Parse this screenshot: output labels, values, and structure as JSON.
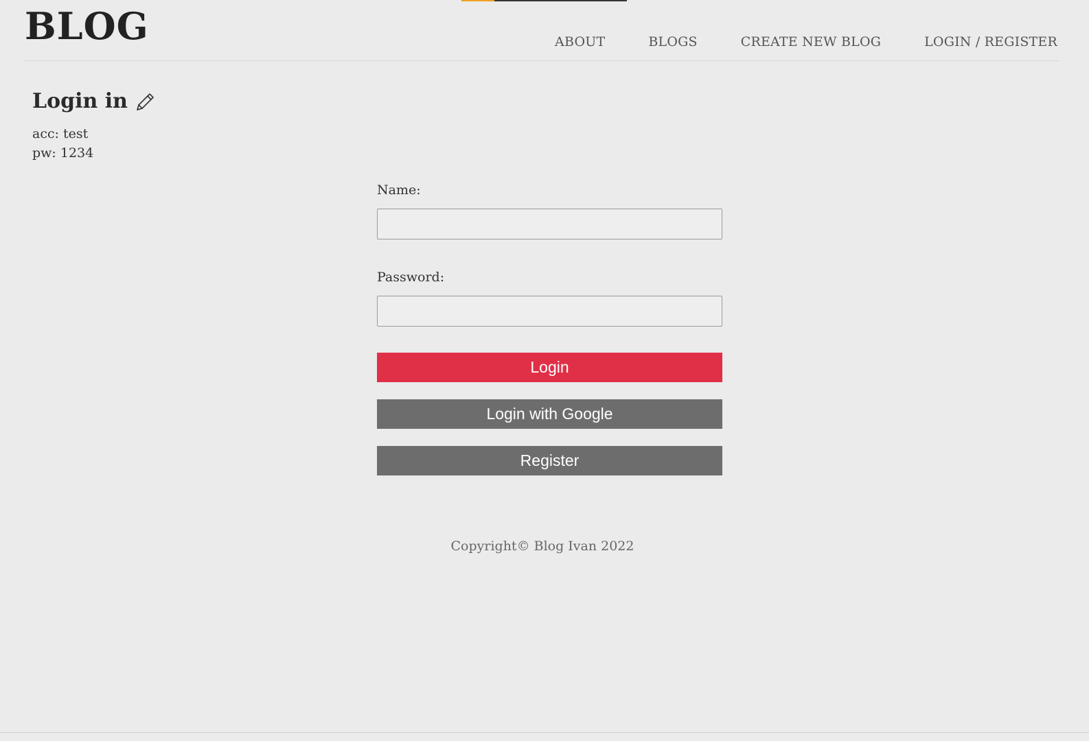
{
  "header": {
    "logo": "BLOG",
    "nav": [
      {
        "label": "ABOUT"
      },
      {
        "label": "BLOGS"
      },
      {
        "label": "CREATE NEW BLOG"
      },
      {
        "label": "LOGIN / REGISTER"
      }
    ]
  },
  "page": {
    "title": "Login in",
    "title_icon": "pencil-icon",
    "hint_account": "acc: test",
    "hint_password": "pw: 1234"
  },
  "form": {
    "name_label": "Name:",
    "name_value": "",
    "password_label": "Password:",
    "password_value": "",
    "login_button": "Login",
    "google_button": "Login with Google",
    "register_button": "Register"
  },
  "footer": {
    "text": "Copyright© Blog Ivan 2022"
  },
  "colors": {
    "background": "#ebebeb",
    "login_button": "#e03048",
    "secondary_button": "#6d6d6d"
  }
}
